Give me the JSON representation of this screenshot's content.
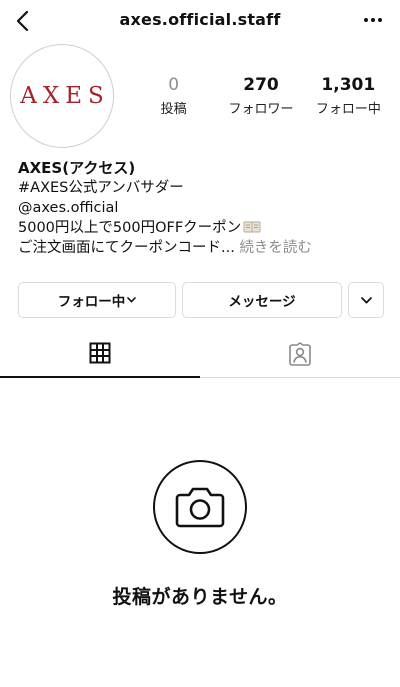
{
  "header": {
    "username": "axes.official.staff",
    "back_icon": "chevron-left-icon",
    "more_icon": "more-horizontal-icon"
  },
  "profile": {
    "avatar_text": "AXES",
    "avatar_color": "#a6232b",
    "stats": [
      {
        "value": "0",
        "label": "投稿"
      },
      {
        "value": "270",
        "label": "フォロワー"
      },
      {
        "value": "1,301",
        "label": "フォロー中"
      }
    ]
  },
  "bio": {
    "name": "AXES(アクセス)",
    "line1": "#AXES公式アンバサダー",
    "line2": "@axes.official",
    "line3": "5000円以上で500円OFFクーポン",
    "line4": "ご注文画面にてクーポンコード...",
    "more_label": "続きを読む"
  },
  "actions": {
    "follow_label": "フォロー中",
    "message_label": "メッセージ"
  },
  "tabs": {
    "grid_icon": "grid-icon",
    "tagged_icon": "tagged-person-icon"
  },
  "empty_state": {
    "icon": "camera-icon",
    "text": "投稿がありません。"
  }
}
